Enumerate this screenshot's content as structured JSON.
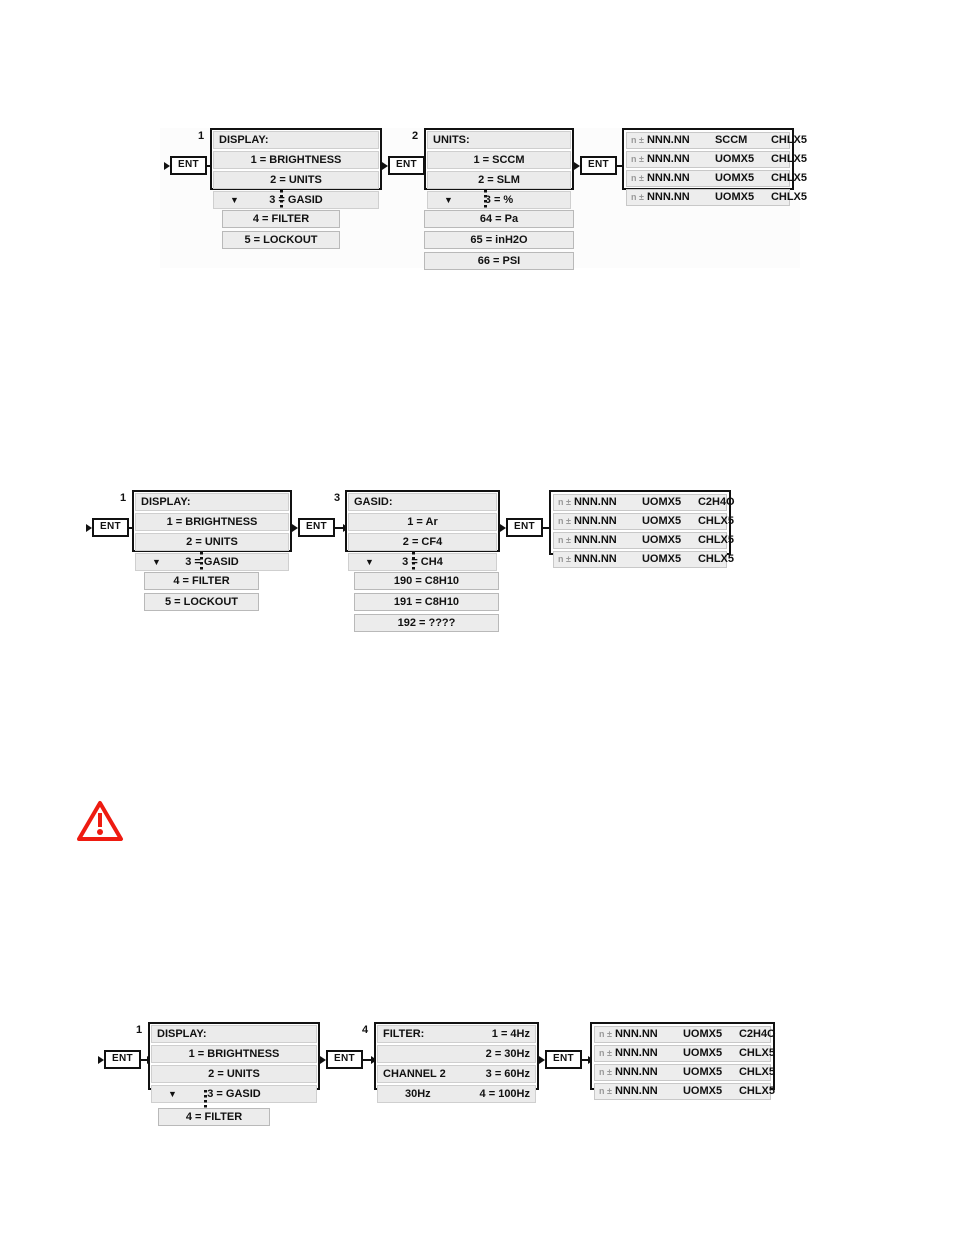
{
  "page": {
    "type": "scanned-manual-page",
    "background": "#ffffff",
    "accent_warning_color": "#ee1b11"
  },
  "diagrams": [
    {
      "id": "display-units-flow",
      "ent_label": "ENT",
      "screens": [
        {
          "index": "1",
          "title": "DISPLAY:",
          "items": [
            "1 = BRIGHTNESS",
            "2 = UNITS",
            "3 = GASID"
          ],
          "selected_item_index": 2,
          "caret": "▼",
          "continuation": [
            "4 = FILTER",
            "5 = LOCKOUT"
          ]
        },
        {
          "index": "2",
          "title": "UNITS:",
          "items": [
            "1 = SCCM",
            "2 = SLM",
            "3 = %"
          ],
          "selected_item_index": 2,
          "caret": "▼",
          "continuation": [
            "64 = Pa",
            "65 = inH2O",
            "66 = PSI"
          ]
        }
      ],
      "readout": {
        "rows": [
          {
            "prefix": "n ±",
            "value": "NNN.NN",
            "uom": "SCCM",
            "channel": "CHLX5"
          },
          {
            "prefix": "n ±",
            "value": "NNN.NN",
            "uom": "UOMX5",
            "channel": "CHLX5"
          },
          {
            "prefix": "n ±",
            "value": "NNN.NN",
            "uom": "UOMX5",
            "channel": "CHLX5"
          },
          {
            "prefix": "n ±",
            "value": "NNN.NN",
            "uom": "UOMX5",
            "channel": "CHLX5"
          }
        ]
      }
    },
    {
      "id": "display-gasid-flow",
      "ent_label": "ENT",
      "screens": [
        {
          "index": "1",
          "title": "DISPLAY:",
          "items": [
            "1 = BRIGHTNESS",
            "2 = UNITS",
            "3 = GASID"
          ],
          "selected_item_index": 2,
          "caret": "▼",
          "continuation": [
            "4 = FILTER",
            "5 = LOCKOUT"
          ]
        },
        {
          "index": "3",
          "title": "GASID:",
          "items": [
            "1 = Ar",
            "2 = CF4",
            "3 = CH4"
          ],
          "selected_item_index": 2,
          "caret": "▼",
          "continuation": [
            "190 = C8H10",
            "191 = C8H10",
            "192 = ????"
          ]
        }
      ],
      "readout": {
        "rows": [
          {
            "prefix": "n ±",
            "value": "NNN.NN",
            "uom": "UOMX5",
            "channel": "C2H4O"
          },
          {
            "prefix": "n ±",
            "value": "NNN.NN",
            "uom": "UOMX5",
            "channel": "CHLX5"
          },
          {
            "prefix": "n ±",
            "value": "NNN.NN",
            "uom": "UOMX5",
            "channel": "CHLX5"
          },
          {
            "prefix": "n ±",
            "value": "NNN.NN",
            "uom": "UOMX5",
            "channel": "CHLX5"
          }
        ]
      }
    },
    {
      "id": "display-filter-flow",
      "ent_label": "ENT",
      "screens": [
        {
          "index": "1",
          "title": "DISPLAY:",
          "items": [
            "1 = BRIGHTNESS",
            "2 = UNITS",
            "3 = GASID"
          ],
          "selected_item_index": 2,
          "caret": "▼",
          "continuation": [
            "4 = FILTER"
          ]
        },
        {
          "index": "4",
          "title": "FILTER:",
          "two_column": true,
          "left_column": [
            "FILTER:",
            "",
            "CHANNEL 2",
            "30Hz"
          ],
          "right_column": [
            "1 = 4Hz",
            "2 = 30Hz",
            "3 = 60Hz",
            "4 = 100Hz"
          ]
        }
      ],
      "readout": {
        "rows": [
          {
            "prefix": "n ±",
            "value": "NNN.NN",
            "uom": "UOMX5",
            "channel": "C2H4O"
          },
          {
            "prefix": "n ±",
            "value": "NNN.NN",
            "uom": "UOMX5",
            "channel": "CHLX5"
          },
          {
            "prefix": "n ±",
            "value": "NNN.NN",
            "uom": "UOMX5",
            "channel": "CHLX5"
          },
          {
            "prefix": "n ±",
            "value": "NNN.NN",
            "uom": "UOMX5",
            "channel": "CHLX5"
          }
        ]
      }
    }
  ],
  "warning_icon": {
    "name": "warning-triangle-icon",
    "glyph": "!",
    "color": "#ee1b11"
  }
}
